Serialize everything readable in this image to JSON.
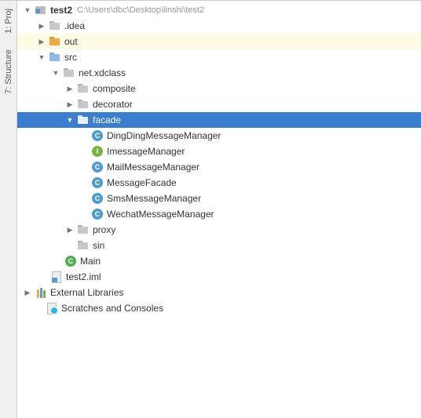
{
  "sidebar_tabs": {
    "project": {
      "label": "1: Proj",
      "number": "1"
    },
    "structure": {
      "label": "7: Structure",
      "number": "7"
    }
  },
  "tree": [
    {
      "id": "root",
      "indent": 0,
      "arrow": "down",
      "icon": "root",
      "label": "test2",
      "bold": true,
      "hint": "C:\\Users\\dbc\\Desktop\\linshi\\test2",
      "interact": true
    },
    {
      "id": "idea",
      "indent": 1,
      "arrow": "right",
      "icon": "folder-gray",
      "label": ".idea",
      "interact": true
    },
    {
      "id": "out",
      "indent": 1,
      "arrow": "right",
      "icon": "folder-orange",
      "label": "out",
      "highlight": true,
      "interact": true
    },
    {
      "id": "src",
      "indent": 1,
      "arrow": "down",
      "icon": "folder-blue",
      "label": "src",
      "interact": true
    },
    {
      "id": "pkg",
      "indent": 2,
      "arrow": "down",
      "icon": "folder-gray",
      "label": "net.xdclass",
      "interact": true
    },
    {
      "id": "composite",
      "indent": 3,
      "arrow": "right",
      "icon": "folder-gray",
      "label": "composite",
      "interact": true
    },
    {
      "id": "decorator",
      "indent": 3,
      "arrow": "right",
      "icon": "folder-gray",
      "label": "decorator",
      "interact": true
    },
    {
      "id": "facade",
      "indent": 3,
      "arrow": "down",
      "icon": "folder-gray",
      "label": "facade",
      "selected": true,
      "interact": true
    },
    {
      "id": "dd",
      "indent": 4,
      "arrow": "",
      "icon": "class-blue",
      "iconText": "C",
      "label": "DingDingMessageManager",
      "interact": true
    },
    {
      "id": "im",
      "indent": 4,
      "arrow": "",
      "icon": "interface",
      "iconText": "I",
      "label": "ImessageManager",
      "interact": true
    },
    {
      "id": "mail",
      "indent": 4,
      "arrow": "",
      "icon": "class-blue",
      "iconText": "C",
      "label": "MailMessageManager",
      "interact": true
    },
    {
      "id": "mf",
      "indent": 4,
      "arrow": "",
      "icon": "class-blue",
      "iconText": "C",
      "label": "MessageFacade",
      "interact": true
    },
    {
      "id": "sms",
      "indent": 4,
      "arrow": "",
      "icon": "class-blue",
      "iconText": "C",
      "label": "SmsMessageManager",
      "interact": true
    },
    {
      "id": "wechat",
      "indent": 4,
      "arrow": "",
      "icon": "class-blue",
      "iconText": "C",
      "label": "WechatMessageManager",
      "interact": true
    },
    {
      "id": "proxy",
      "indent": 3,
      "arrow": "right",
      "icon": "folder-gray",
      "label": "proxy",
      "interact": true
    },
    {
      "id": "sin",
      "indent": 3,
      "arrow": "",
      "icon": "folder-gray",
      "label": "sin",
      "interact": true
    },
    {
      "id": "main",
      "indent": 3,
      "arrow": "",
      "icon": "class",
      "iconText": "C",
      "label": "Main",
      "interact": true,
      "indentAdj": -16
    },
    {
      "id": "iml",
      "indent": 2,
      "arrow": "",
      "icon": "iml",
      "label": "test2.iml",
      "interact": true,
      "indentAdj": -16
    },
    {
      "id": "ext",
      "indent": 0,
      "arrow": "right",
      "icon": "libs",
      "label": "External Libraries",
      "interact": true
    },
    {
      "id": "scratch",
      "indent": 0,
      "arrow": "",
      "icon": "scratch",
      "label": "Scratches and Consoles",
      "interact": true,
      "indentExtra": 14
    }
  ]
}
